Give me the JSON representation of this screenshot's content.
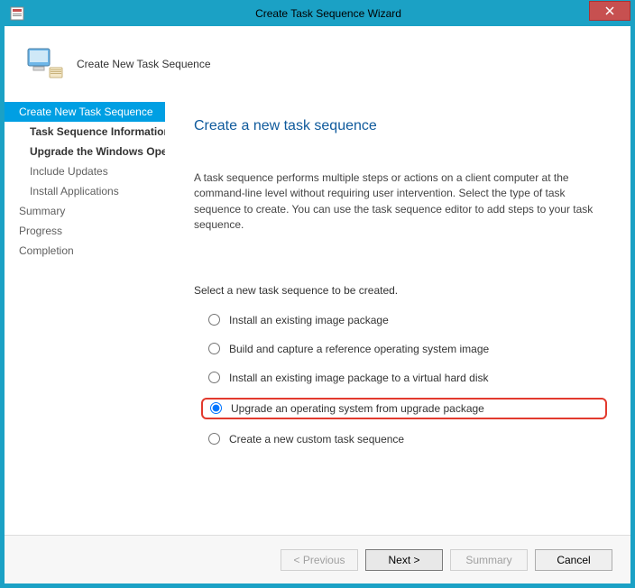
{
  "titlebar": {
    "title": "Create Task Sequence Wizard",
    "close": "X"
  },
  "header": {
    "subtitle": "Create New Task Sequence"
  },
  "sidebar": {
    "items": [
      {
        "label": "Create New Task Sequence",
        "selected": true,
        "indent": false
      },
      {
        "label": "Task Sequence Information",
        "indent": true,
        "bold": true
      },
      {
        "label": "Upgrade the Windows Operating System",
        "indent": true,
        "bold": true
      },
      {
        "label": "Include Updates",
        "indent": true
      },
      {
        "label": "Install Applications",
        "indent": true
      },
      {
        "label": "Summary"
      },
      {
        "label": "Progress"
      },
      {
        "label": "Completion"
      }
    ]
  },
  "main": {
    "heading": "Create a new task sequence",
    "description": "A task sequence performs multiple steps or actions on a client computer at the command-line level without requiring user intervention. Select the type of task sequence to create. You can use the task sequence editor to add steps to your task sequence.",
    "selectLabel": "Select a new task sequence to be created.",
    "options": [
      {
        "label": "Install an existing image package",
        "selected": false
      },
      {
        "label": "Build and capture a reference operating system image",
        "selected": false
      },
      {
        "label": "Install an existing image package to a virtual hard disk",
        "selected": false
      },
      {
        "label": "Upgrade an operating system from upgrade package",
        "selected": true,
        "highlight": true
      },
      {
        "label": "Create a new custom task sequence",
        "selected": false
      }
    ]
  },
  "footer": {
    "previous": "< Previous",
    "next": "Next >",
    "summary": "Summary",
    "cancel": "Cancel"
  },
  "scroll": {
    "thumb": "|||"
  }
}
